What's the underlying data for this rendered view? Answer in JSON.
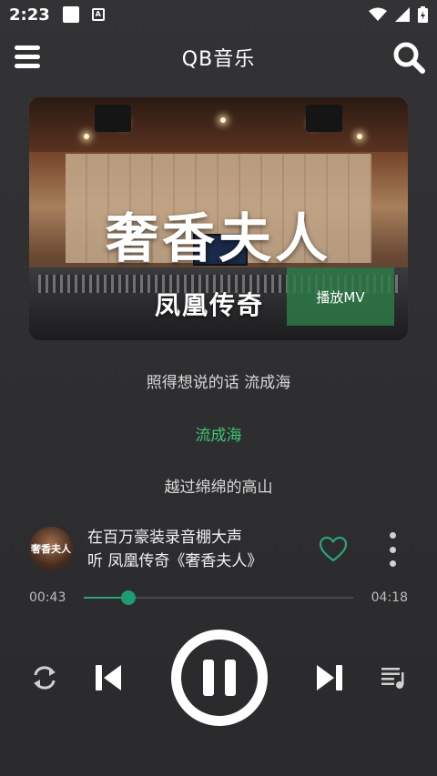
{
  "status_bar": {
    "time": "2:23",
    "icons": [
      "notification-square-icon",
      "accessibility-a-icon",
      "wifi-icon",
      "signal-icon",
      "battery-icon"
    ]
  },
  "app_bar": {
    "title": "QB音乐",
    "menu_icon": "hamburger-menu-icon",
    "search_icon": "search-icon"
  },
  "album_art": {
    "title": "奢香夫人",
    "subtitle": "凤凰传奇",
    "mv_button": "播放MV"
  },
  "lyrics": {
    "previous": "照得想说的话 流成海",
    "current": "流成海",
    "next": "越过绵绵的高山"
  },
  "now_playing": {
    "thumb_text": "奢香夫人",
    "line1": "在百万豪装录音棚大声",
    "line2": "听 凤凰传奇《奢香夫人》",
    "favorite_icon": "heart-outline-icon",
    "more_icon": "more-vertical-icon"
  },
  "progress": {
    "current": "00:43",
    "total": "04:18",
    "fraction": 0.167
  },
  "controls": {
    "repeat_icon": "repeat-icon",
    "previous_icon": "skip-previous-icon",
    "pause_icon": "pause-icon",
    "next_icon": "skip-next-icon",
    "playlist_icon": "playlist-icon"
  },
  "colors": {
    "accent": "#2aa57a",
    "current_lyric": "#3ec46f",
    "mv_button_bg": "#2e7d48",
    "background": "#2f2f31"
  }
}
